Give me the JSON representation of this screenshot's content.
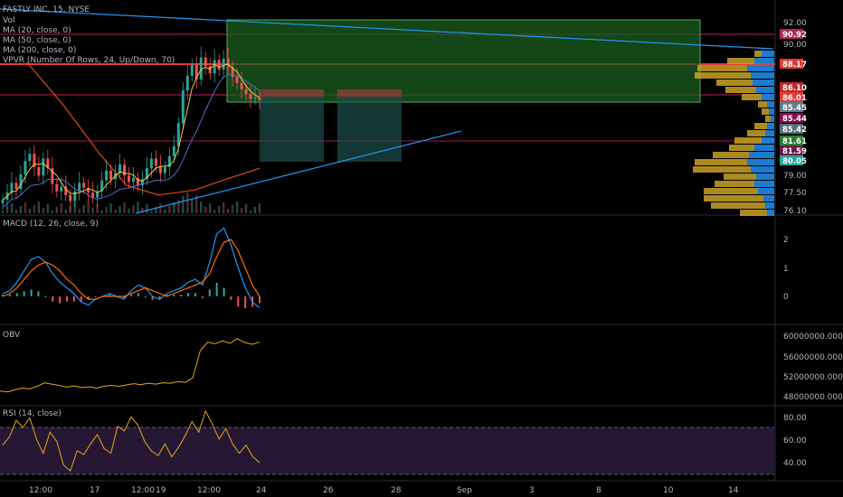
{
  "header": {
    "symbol_line": "FASTLY INC, 15, NYSE",
    "indicators": [
      "Vol",
      "MA (20, close, 0)",
      "MA (50, close, 0)",
      "MA (200, close, 0)",
      "VPVR (Number Of Rows, 24, Up/Down, 70)"
    ]
  },
  "panes": {
    "macd_title": "MACD (12, 26, close, 9)",
    "obv_title": "OBV",
    "rsi_title": "RSI (14, close)"
  },
  "x_axis": {
    "labels": [
      "12:00",
      "17",
      "12:00",
      "19",
      "12:00",
      "24",
      "26",
      "28",
      "Sep",
      "3",
      "8",
      "10",
      "14"
    ]
  },
  "price_axis": {
    "ticks": [
      "92.00",
      "90.00",
      "79.00",
      "77.50",
      "76.10"
    ],
    "badges": [
      {
        "text": "90.92",
        "color": "#b0275a"
      },
      {
        "text": "88.17",
        "color": "#e53935"
      },
      {
        "text": "86.10",
        "color": "#c62828"
      },
      {
        "text": "86.01",
        "color": "#e53935"
      },
      {
        "text": "85.45",
        "color": "#607d8b"
      },
      {
        "text": "85.44",
        "color": "#880e4f"
      },
      {
        "text": "85.42",
        "color": "#546e7a"
      },
      {
        "text": "81.61",
        "color": "#2e7d32"
      },
      {
        "text": "81.59",
        "color": "#6a1b4d"
      },
      {
        "text": "80.05",
        "color": "#26a69a"
      }
    ]
  },
  "macd_axis": {
    "ticks": [
      "2",
      "1",
      "0"
    ]
  },
  "obv_axis": {
    "ticks": [
      "60000000.00000000",
      "56000000.00000000",
      "52000000.00000000",
      "48000000.00000000"
    ]
  },
  "rsi_axis": {
    "ticks": [
      "80.00",
      "60.00",
      "40.00"
    ]
  },
  "colors": {
    "background": "#000000",
    "up_candle": "#26a69a",
    "down_candle": "#ef5350",
    "ma20": "#f6c445",
    "ma50": "#5c6bc0",
    "ma200": "#e64a19",
    "trendline": "#2196f3",
    "zone": "#1b5e20",
    "obv": "#e6a817",
    "rsi": "#e6a817",
    "macd": "#2196f3",
    "signal": "#ff6d00"
  },
  "chart_data": {
    "type": "line",
    "title": "FASTLY INC, 15, NYSE",
    "price": {
      "ylim": [
        76.1,
        92.0
      ],
      "close_series": [
        77.2,
        77.8,
        78.6,
        78.1,
        79.3,
        80.4,
        81.0,
        79.9,
        79.2,
        80.6,
        79.8,
        78.5,
        77.9,
        78.3,
        77.6,
        77.1,
        77.9,
        78.6,
        78.2,
        77.8,
        77.4,
        77.9,
        78.8,
        79.6,
        78.9,
        79.4,
        80.1,
        79.2,
        78.7,
        79.0,
        78.4,
        78.9,
        79.8,
        80.6,
        80.0,
        79.4,
        79.9,
        80.8,
        81.6,
        83.5,
        86.2,
        87.4,
        88.3,
        87.1,
        88.9,
        88.2,
        87.6,
        88.7,
        87.9,
        88.8,
        88.1,
        87.3,
        86.8,
        86.3,
        85.9,
        85.5,
        85.6,
        85.4
      ],
      "last_price": 85.42
    },
    "macd": {
      "ylim": [
        -0.6,
        2.5
      ],
      "macd": [
        0.1,
        0.2,
        0.5,
        0.9,
        1.3,
        1.4,
        1.2,
        0.8,
        0.5,
        0.3,
        0.1,
        -0.2,
        -0.3,
        -0.1,
        0.0,
        0.1,
        0.0,
        -0.1,
        0.2,
        0.4,
        0.3,
        0.0,
        -0.1,
        0.1,
        0.2,
        0.3,
        0.5,
        0.6,
        0.4,
        1.2,
        2.2,
        2.4,
        1.8,
        1.0,
        0.3,
        -0.2,
        -0.4
      ],
      "signal": [
        0.0,
        0.1,
        0.3,
        0.6,
        0.9,
        1.1,
        1.2,
        1.1,
        0.9,
        0.6,
        0.4,
        0.1,
        -0.1,
        -0.1,
        0.0,
        0.0,
        0.0,
        0.0,
        0.1,
        0.2,
        0.3,
        0.2,
        0.1,
        0.0,
        0.1,
        0.2,
        0.3,
        0.4,
        0.5,
        0.8,
        1.4,
        1.9,
        2.0,
        1.6,
        1.0,
        0.4,
        0.0
      ]
    },
    "obv": {
      "ylim": [
        47000000,
        62000000
      ],
      "values": [
        48500000,
        48300000,
        48800000,
        49200000,
        49000000,
        49600000,
        50400000,
        50100000,
        49800000,
        49400000,
        49700000,
        49300000,
        49500000,
        49200000,
        49600000,
        49800000,
        49600000,
        49900000,
        50200000,
        50000000,
        50300000,
        50100000,
        50400000,
        50300000,
        50700000,
        50500000,
        51600000,
        57800000,
        59800000,
        59400000,
        60100000,
        59500000,
        60600000,
        59700000,
        59300000,
        59800000
      ]
    },
    "rsi": {
      "ylim": [
        25,
        90
      ],
      "values": [
        55,
        62,
        76,
        70,
        78,
        60,
        48,
        66,
        58,
        38,
        33,
        50,
        47,
        56,
        64,
        52,
        48,
        71,
        67,
        79,
        72,
        58,
        50,
        46,
        56,
        45,
        53,
        63,
        75,
        66,
        84,
        73,
        60,
        69,
        56,
        48,
        55,
        45,
        40
      ]
    }
  }
}
